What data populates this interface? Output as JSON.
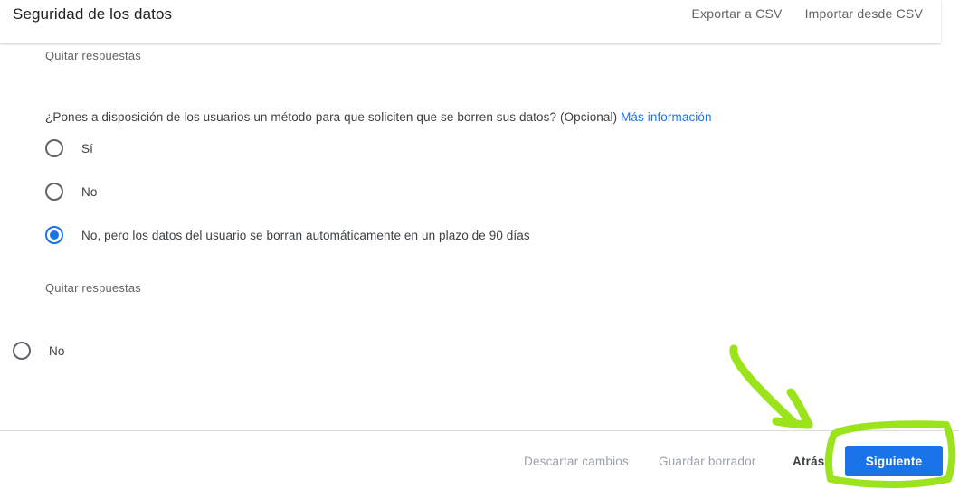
{
  "header": {
    "title": "Seguridad de los datos",
    "export_label": "Exportar a CSV",
    "import_label": "Importar desde CSV"
  },
  "section1": {
    "clear_label": "Quitar respuestas"
  },
  "question": {
    "text": "¿Pones a disposición de los usuarios un método para que soliciten que se borren sus datos? (Opcional)",
    "more_label": "Más información",
    "options": [
      {
        "label": "Sí",
        "selected": false
      },
      {
        "label": "No",
        "selected": false
      },
      {
        "label": "No, pero los datos del usuario se borran automáticamente en un plazo de 90 días",
        "selected": true
      }
    ],
    "clear_label": "Quitar respuestas"
  },
  "extra_option": {
    "label": "No",
    "selected": false
  },
  "footer": {
    "discard_label": "Descartar cambios",
    "save_draft_label": "Guardar borrador",
    "back_label": "Atrás",
    "next_label": "Siguiente"
  },
  "colors": {
    "accent": "#1a73e8",
    "annotation": "#9be31a"
  }
}
